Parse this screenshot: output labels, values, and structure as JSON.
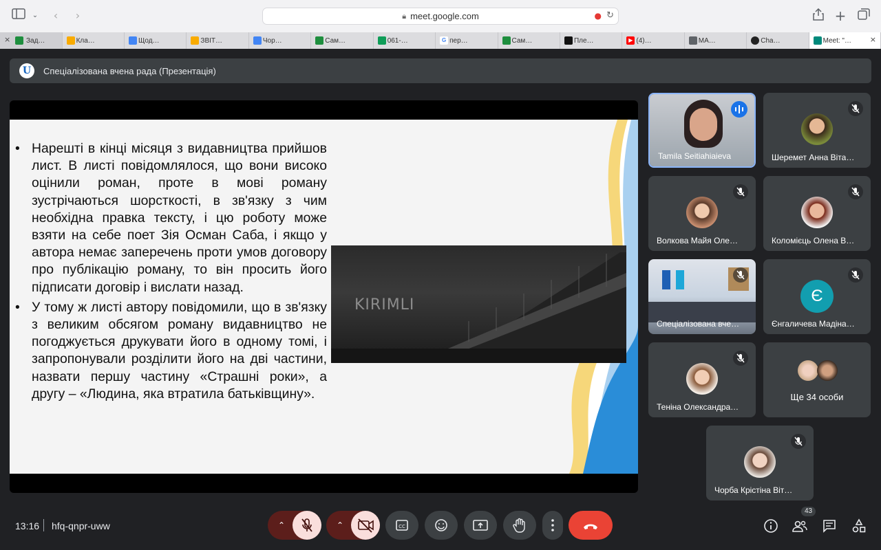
{
  "browser": {
    "url": "meet.google.com",
    "tabs": [
      {
        "label": "Зад…",
        "color": "#1e8e3e"
      },
      {
        "label": "Кла…",
        "color": "#f9ab00"
      },
      {
        "label": "Щод…",
        "color": "#4285f4"
      },
      {
        "label": "ЗВІТ…",
        "color": "#f9ab00"
      },
      {
        "label": "Чор…",
        "color": "#4285f4"
      },
      {
        "label": "Сам…",
        "color": "#1e8e3e"
      },
      {
        "label": "061-…",
        "color": "#0f9d58"
      },
      {
        "label": "пер…",
        "color": "#ffffff"
      },
      {
        "label": "Сам…",
        "color": "#1e8e3e"
      },
      {
        "label": "Пле…",
        "color": "#111111"
      },
      {
        "label": "(4)…",
        "color": "#ff0000"
      },
      {
        "label": "МА…",
        "color": "#5f6368"
      },
      {
        "label": "Cha…",
        "color": "#222222"
      },
      {
        "label": "Meet: \"…",
        "color": "#00897b"
      }
    ]
  },
  "meeting": {
    "presentation_title": "Спеціалізована вчена рада (Презентація)",
    "time": "13:16",
    "code": "hfq-qnpr-uww",
    "participant_count": "43"
  },
  "slide": {
    "bullets": [
      "Нарешті в кінці місяця з видавництва прийшов лист. В листі повідомлялося, що вони високо оцінили роман, проте в мові роману зустрічаються шорсткості, в зв'язку з чим необхідна правка тексту, і цю роботу може взяти на себе поет Зія Осман Саба, і якщо у автора немає заперечень проти умов договору про публікацію роману, то він просить його підписати договір і вислати назад.",
      "У тому ж листі автору повідомили, що в зв'язку з великим обсягом роману видавництво не погоджується друкувати його в одному томі, і запропонували розділити його на дві частини, назвати першу частину «Страшні роки», а другу – «Людина, яка втратила батьківщину»."
    ],
    "image_caption": "KIRIMLI"
  },
  "participants": [
    {
      "name": "Tamila Seitiahiaieva",
      "state": "speaking"
    },
    {
      "name": "Шеремет Анна Віта…",
      "state": "muted"
    },
    {
      "name": "Волкова Майя Оле…",
      "state": "muted"
    },
    {
      "name": "Коломієць Олена В…",
      "state": "muted"
    },
    {
      "name": "Спеціалізована вче…",
      "state": "muted"
    },
    {
      "name": "Єнгаличева Мадіна…",
      "state": "muted",
      "initial": "Є"
    },
    {
      "name": "Теніна Олександра…",
      "state": "muted"
    },
    {
      "name": "Ще 34 особи",
      "state": "group"
    },
    {
      "name": "Чорба Крістіна Віт…",
      "state": "muted"
    }
  ],
  "colors": {
    "background": "#202124",
    "tile": "#3c4043",
    "end_call": "#ea4335",
    "speaking": "#1a73e8"
  }
}
